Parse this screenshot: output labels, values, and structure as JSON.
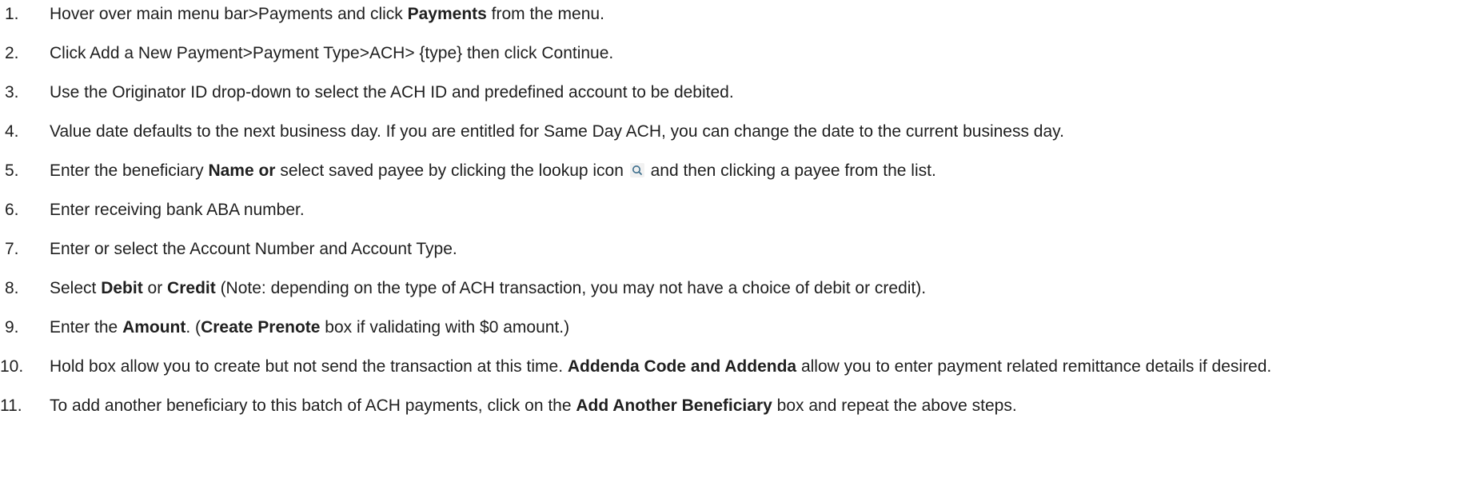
{
  "steps": [
    {
      "num": "1.",
      "parts": [
        {
          "t": "Hover over main menu bar>Payments and click "
        },
        {
          "t": "Payments",
          "b": true
        },
        {
          "t": " from the menu."
        }
      ]
    },
    {
      "num": "2.",
      "parts": [
        {
          "t": "Click Add a New Payment>Payment Type>ACH> {type} then click Continue."
        }
      ]
    },
    {
      "num": "3.",
      "parts": [
        {
          "t": "Use the Originator ID drop-down to select the ACH ID and predefined account to be debited."
        }
      ]
    },
    {
      "num": "4.",
      "parts": [
        {
          "t": "Value date defaults to the next business day. If you are entitled for Same Day ACH, you can change the date to the current business day."
        }
      ]
    },
    {
      "num": "5.",
      "parts": [
        {
          "t": "Enter the beneficiary "
        },
        {
          "t": "Name or",
          "b": true
        },
        {
          "t": " select saved payee by clicking the lookup icon "
        },
        {
          "icon": "lookup-icon"
        },
        {
          "t": " and then clicking a payee from the list."
        }
      ]
    },
    {
      "num": "6.",
      "parts": [
        {
          "t": "Enter receiving bank ABA number."
        }
      ]
    },
    {
      "num": "7.",
      "parts": [
        {
          "t": "Enter or select the Account Number and Account Type."
        }
      ]
    },
    {
      "num": "8.",
      "parts": [
        {
          "t": "Select "
        },
        {
          "t": "Debit",
          "b": true
        },
        {
          "t": " or "
        },
        {
          "t": "Credit",
          "b": true
        },
        {
          "t": " (Note: depending on the type of ACH transaction, you may not have a choice of debit or credit)."
        }
      ]
    },
    {
      "num": "9.",
      "parts": [
        {
          "t": "Enter the "
        },
        {
          "t": "Amount",
          "b": true
        },
        {
          "t": ". ("
        },
        {
          "t": "Create Prenote",
          "b": true
        },
        {
          "t": " box if validating with $0 amount.)"
        }
      ]
    },
    {
      "num": "10.",
      "parts": [
        {
          "t": "Hold box allow you to create but not send the transaction at this time. "
        },
        {
          "t": "Addenda Code and Addenda",
          "b": true
        },
        {
          "t": " allow you to enter payment related remittance details if desired."
        }
      ]
    },
    {
      "num": "11.",
      "parts": [
        {
          "t": "To add another beneficiary to this batch of ACH payments, click on the "
        },
        {
          "t": "Add Another Beneficiary",
          "b": true
        },
        {
          "t": " box and repeat the above steps."
        }
      ]
    }
  ]
}
